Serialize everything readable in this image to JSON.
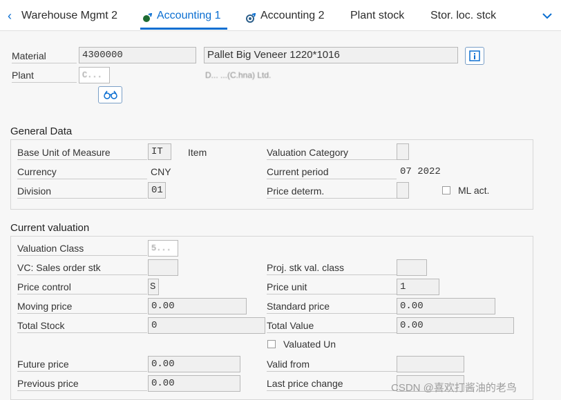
{
  "tabs": {
    "warehouse": "Warehouse Mgmt 2",
    "accounting1": "Accounting 1",
    "accounting2": "Accounting 2",
    "plant_stock": "Plant stock",
    "stor_loc": "Stor. loc. stck"
  },
  "header": {
    "material_label": "Material",
    "material_value": "4300000",
    "material_desc": "Pallet Big Veneer 1220*1016",
    "plant_label": "Plant",
    "plant_value": "C...",
    "plant_desc": "D... ...(C.hna) Ltd."
  },
  "general": {
    "title": "General Data",
    "base_uom_label": "Base Unit of Measure",
    "base_uom_value": "IT",
    "base_uom_text": "Item",
    "valuation_category_label": "Valuation Category",
    "currency_label": "Currency",
    "currency_value": "CNY",
    "current_period_label": "Current period",
    "current_period_value": "07 2022",
    "division_label": "Division",
    "division_value": "01",
    "price_determ_label": "Price determ.",
    "ml_act_label": "ML act."
  },
  "valuation": {
    "title": "Current valuation",
    "valuation_class_label": "Valuation Class",
    "valuation_class_value": "5...",
    "vc_sales_label": "VC: Sales order stk",
    "proj_stk_label": "Proj. stk val. class",
    "price_control_label": "Price control",
    "price_control_value": "S",
    "price_unit_label": "Price unit",
    "price_unit_value": "1",
    "moving_price_label": "Moving price",
    "moving_price_value": "0.00",
    "standard_price_label": "Standard price",
    "standard_price_value": "0.00",
    "total_stock_label": "Total Stock",
    "total_stock_value": "0",
    "total_value_label": "Total Value",
    "total_value_value": "0.00",
    "valuated_un_label": "Valuated Un",
    "future_price_label": "Future price",
    "future_price_value": "0.00",
    "valid_from_label": "Valid from",
    "previous_price_label": "Previous price",
    "previous_price_value": "0.00",
    "last_price_change_label": "Last price change"
  },
  "watermark": "CSDN @喜欢打酱油的老鸟",
  "icons": {
    "back": "chevron-left-icon",
    "more": "chevron-down-icon",
    "info": "info-icon",
    "display": "glasses-icon"
  }
}
